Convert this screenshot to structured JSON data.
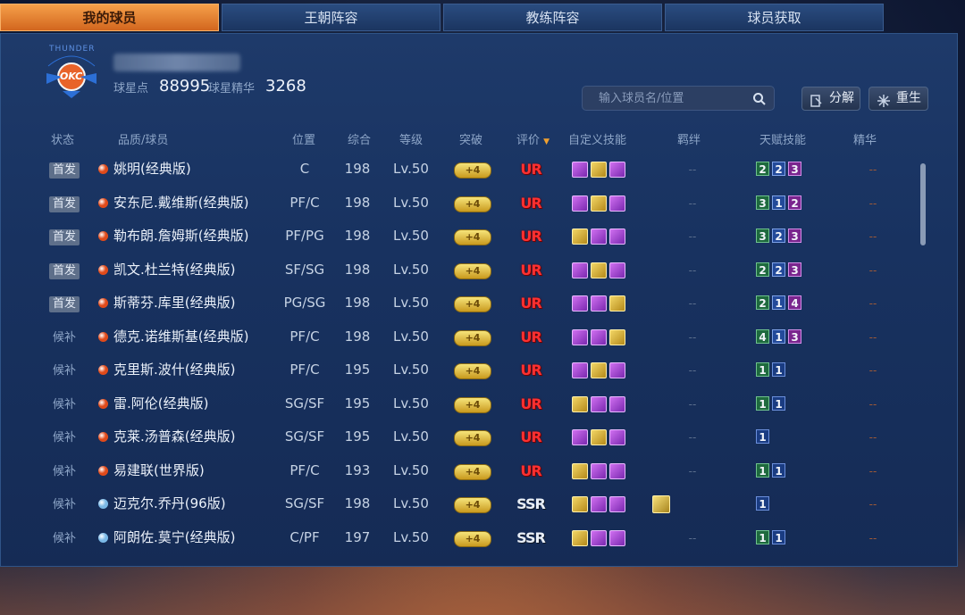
{
  "tabs": [
    {
      "label": "我的球员",
      "active": true
    },
    {
      "label": "王朝阵容",
      "active": false
    },
    {
      "label": "教练阵容",
      "active": false
    },
    {
      "label": "球员获取",
      "active": false
    }
  ],
  "team_logo": {
    "text": "OKC",
    "arc_text": "THUNDER"
  },
  "account": {
    "star_points_label": "球星点",
    "star_points_value": "88995",
    "essence_label": "球星精华",
    "essence_value": "3268"
  },
  "search": {
    "placeholder": "输入球员名/位置"
  },
  "buttons": {
    "decompose": "分解",
    "rebirth": "重生"
  },
  "table": {
    "headers": {
      "status": "状态",
      "player": "品质/球员",
      "position": "位置",
      "overall": "综合",
      "level": "等级",
      "breakthrough": "突破",
      "rating": "评价",
      "skills": "自定义技能",
      "bond": "羁绊",
      "talents": "天赋技能",
      "essence": "精华"
    },
    "rows": [
      {
        "status": "首发",
        "starter": true,
        "dot": "#e04a1a",
        "name": "姚明(经典版)",
        "position": "C",
        "overall": "198",
        "level": "Lv.50",
        "break": "+4",
        "rating": "UR",
        "skills": [
          "p",
          "g",
          "p"
        ],
        "bond": "--",
        "talents": [
          {
            "v": "2",
            "c": "green"
          },
          {
            "v": "2",
            "c": "blue"
          },
          {
            "v": "3",
            "c": "purple"
          }
        ],
        "essence": "--"
      },
      {
        "status": "首发",
        "starter": true,
        "dot": "#e04a1a",
        "name": "安东尼.戴维斯(经典版)",
        "position": "PF/C",
        "overall": "198",
        "level": "Lv.50",
        "break": "+4",
        "rating": "UR",
        "skills": [
          "p",
          "g",
          "p"
        ],
        "bond": "--",
        "talents": [
          {
            "v": "3",
            "c": "green"
          },
          {
            "v": "1",
            "c": "blue"
          },
          {
            "v": "2",
            "c": "purple"
          }
        ],
        "essence": "--"
      },
      {
        "status": "首发",
        "starter": true,
        "dot": "#e04a1a",
        "name": "勒布朗.詹姆斯(经典版)",
        "position": "PF/PG",
        "overall": "198",
        "level": "Lv.50",
        "break": "+4",
        "rating": "UR",
        "skills": [
          "g",
          "p",
          "p"
        ],
        "bond": "--",
        "talents": [
          {
            "v": "3",
            "c": "green"
          },
          {
            "v": "2",
            "c": "blue"
          },
          {
            "v": "3",
            "c": "purple"
          }
        ],
        "essence": "--"
      },
      {
        "status": "首发",
        "starter": true,
        "dot": "#e04a1a",
        "name": "凯文.杜兰特(经典版)",
        "position": "SF/SG",
        "overall": "198",
        "level": "Lv.50",
        "break": "+4",
        "rating": "UR",
        "skills": [
          "p",
          "g",
          "p"
        ],
        "bond": "--",
        "talents": [
          {
            "v": "2",
            "c": "green"
          },
          {
            "v": "2",
            "c": "blue"
          },
          {
            "v": "3",
            "c": "purple"
          }
        ],
        "essence": "--"
      },
      {
        "status": "首发",
        "starter": true,
        "dot": "#e04a1a",
        "name": "斯蒂芬.库里(经典版)",
        "position": "PG/SG",
        "overall": "198",
        "level": "Lv.50",
        "break": "+4",
        "rating": "UR",
        "skills": [
          "p",
          "p",
          "g"
        ],
        "bond": "--",
        "talents": [
          {
            "v": "2",
            "c": "green"
          },
          {
            "v": "1",
            "c": "blue"
          },
          {
            "v": "4",
            "c": "purple"
          }
        ],
        "essence": "--"
      },
      {
        "status": "候补",
        "starter": false,
        "dot": "#e04a1a",
        "name": "德克.诺维斯基(经典版)",
        "position": "PF/C",
        "overall": "198",
        "level": "Lv.50",
        "break": "+4",
        "rating": "UR",
        "skills": [
          "p",
          "p",
          "g"
        ],
        "bond": "--",
        "talents": [
          {
            "v": "4",
            "c": "green"
          },
          {
            "v": "1",
            "c": "blue"
          },
          {
            "v": "3",
            "c": "purple"
          }
        ],
        "essence": "--"
      },
      {
        "status": "候补",
        "starter": false,
        "dot": "#e04a1a",
        "name": "克里斯.波什(经典版)",
        "position": "PF/C",
        "overall": "195",
        "level": "Lv.50",
        "break": "+4",
        "rating": "UR",
        "skills": [
          "p",
          "g",
          "p"
        ],
        "bond": "--",
        "talents": [
          {
            "v": "1",
            "c": "green"
          },
          {
            "v": "1",
            "c": "navy"
          }
        ],
        "essence": "--"
      },
      {
        "status": "候补",
        "starter": false,
        "dot": "#e04a1a",
        "name": "雷.阿伦(经典版)",
        "position": "SG/SF",
        "overall": "195",
        "level": "Lv.50",
        "break": "+4",
        "rating": "UR",
        "skills": [
          "g",
          "p",
          "p"
        ],
        "bond": "--",
        "talents": [
          {
            "v": "1",
            "c": "green"
          },
          {
            "v": "1",
            "c": "navy"
          }
        ],
        "essence": "--"
      },
      {
        "status": "候补",
        "starter": false,
        "dot": "#e04a1a",
        "name": "克莱.汤普森(经典版)",
        "position": "SG/SF",
        "overall": "195",
        "level": "Lv.50",
        "break": "+4",
        "rating": "UR",
        "skills": [
          "p",
          "g",
          "p"
        ],
        "bond": "--",
        "talents": [
          {
            "v": "1",
            "c": "navy"
          }
        ],
        "essence": "--"
      },
      {
        "status": "候补",
        "starter": false,
        "dot": "#e04a1a",
        "name": "易建联(世界版)",
        "position": "PF/C",
        "overall": "193",
        "level": "Lv.50",
        "break": "+4",
        "rating": "UR",
        "skills": [
          "g",
          "p",
          "p"
        ],
        "bond": "--",
        "talents": [
          {
            "v": "1",
            "c": "green"
          },
          {
            "v": "1",
            "c": "navy"
          }
        ],
        "essence": "--"
      },
      {
        "status": "候补",
        "starter": false,
        "dot": "#7ab8e6",
        "name": "迈克尔.乔丹(96版)",
        "position": "SG/SF",
        "overall": "198",
        "level": "Lv.50",
        "break": "+4",
        "rating": "SSR",
        "skills": [
          "g",
          "p",
          "p"
        ],
        "bond": "icon",
        "talents": [
          {
            "v": "1",
            "c": "navy"
          }
        ],
        "essence": "--"
      },
      {
        "status": "候补",
        "starter": false,
        "dot": "#7ab8e6",
        "name": "阿朗佐.莫宁(经典版)",
        "position": "C/PF",
        "overall": "197",
        "level": "Lv.50",
        "break": "+4",
        "rating": "SSR",
        "skills": [
          "g",
          "p",
          "p"
        ],
        "bond": "--",
        "talents": [
          {
            "v": "1",
            "c": "green"
          },
          {
            "v": "1",
            "c": "navy"
          }
        ],
        "essence": "--"
      }
    ]
  }
}
